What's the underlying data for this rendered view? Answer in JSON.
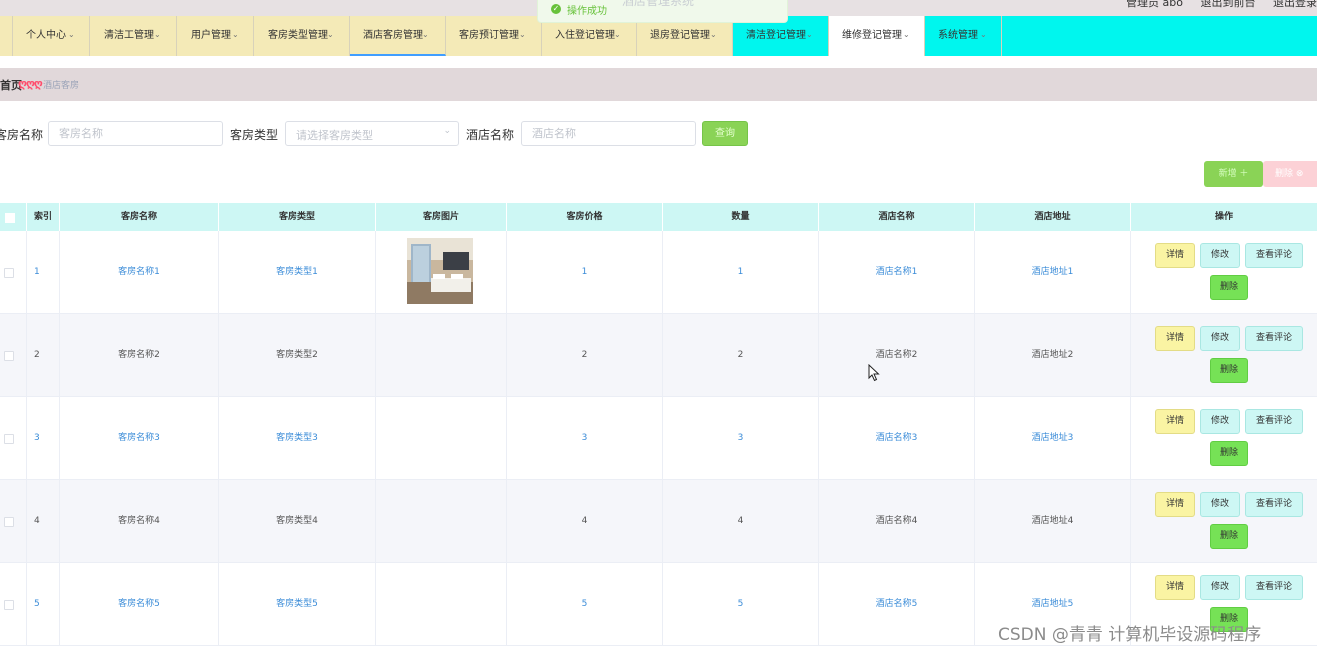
{
  "topbar": {
    "user_label": "管理员 abo",
    "front_link": "退出到前台",
    "logout_link": "退出登录"
  },
  "toast": {
    "message": "操作成功",
    "system_title": "酒店管理系统"
  },
  "nav": {
    "items": [
      {
        "label": "个人中心"
      },
      {
        "label": "清洁工管理"
      },
      {
        "label": "用户管理"
      },
      {
        "label": "客房类型管理"
      },
      {
        "label": "酒店客房管理"
      },
      {
        "label": "客房预订管理"
      },
      {
        "label": "入住登记管理"
      },
      {
        "label": "退房登记管理"
      },
      {
        "label": "清洁登记管理"
      },
      {
        "label": "维修登记管理"
      },
      {
        "label": "系统管理"
      }
    ]
  },
  "breadcrumb": {
    "home": "首页",
    "separator": "ღღღ",
    "current": "酒店客房"
  },
  "search": {
    "room_name_label": "客房名称",
    "room_name_placeholder": "客房名称",
    "room_type_label": "客房类型",
    "room_type_placeholder": "请选择客房类型",
    "hotel_name_label": "酒店名称",
    "hotel_name_placeholder": "酒店名称",
    "query_button": "查询"
  },
  "actions": {
    "add": "新增 ＋",
    "delete": "删除 ⊗"
  },
  "table": {
    "headers": [
      "索引",
      "客房名称",
      "客房类型",
      "客房图片",
      "客房价格",
      "数量",
      "酒店名称",
      "酒店地址",
      "操作"
    ],
    "rows": [
      {
        "index": "1",
        "name": "客房名称1",
        "type": "客房类型1",
        "price": "1",
        "qty": "1",
        "hotel": "酒店名称1",
        "address": "酒店地址1"
      },
      {
        "index": "2",
        "name": "客房名称2",
        "type": "客房类型2",
        "price": "2",
        "qty": "2",
        "hotel": "酒店名称2",
        "address": "酒店地址2"
      },
      {
        "index": "3",
        "name": "客房名称3",
        "type": "客房类型3",
        "price": "3",
        "qty": "3",
        "hotel": "酒店名称3",
        "address": "酒店地址3"
      },
      {
        "index": "4",
        "name": "客房名称4",
        "type": "客房类型4",
        "price": "4",
        "qty": "4",
        "hotel": "酒店名称4",
        "address": "酒店地址4"
      },
      {
        "index": "5",
        "name": "客房名称5",
        "type": "客房类型5",
        "price": "5",
        "qty": "5",
        "hotel": "酒店名称5",
        "address": "酒店地址5"
      }
    ],
    "row_actions": {
      "detail": "详情",
      "edit": "修改",
      "review": "查看评论",
      "remove": "删除"
    }
  },
  "watermark": "CSDN @青青 计算机毕设源码程序"
}
